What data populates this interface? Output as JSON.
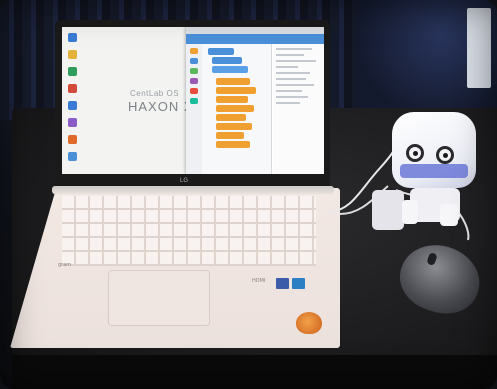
{
  "screen": {
    "brand_small": "CentLab OS",
    "brand_large": "HAXON  XR OS"
  },
  "laptop": {
    "lid_logo": "LG",
    "deck_label": "HDMI",
    "deck_brand": "gram"
  },
  "colors": {
    "robot_accent": "#6c78d8",
    "app_toolbar": "#4a90d9",
    "block_orange": "#f0a030",
    "block_blue": "#4a90d9",
    "deck": "#f2e8e4"
  }
}
